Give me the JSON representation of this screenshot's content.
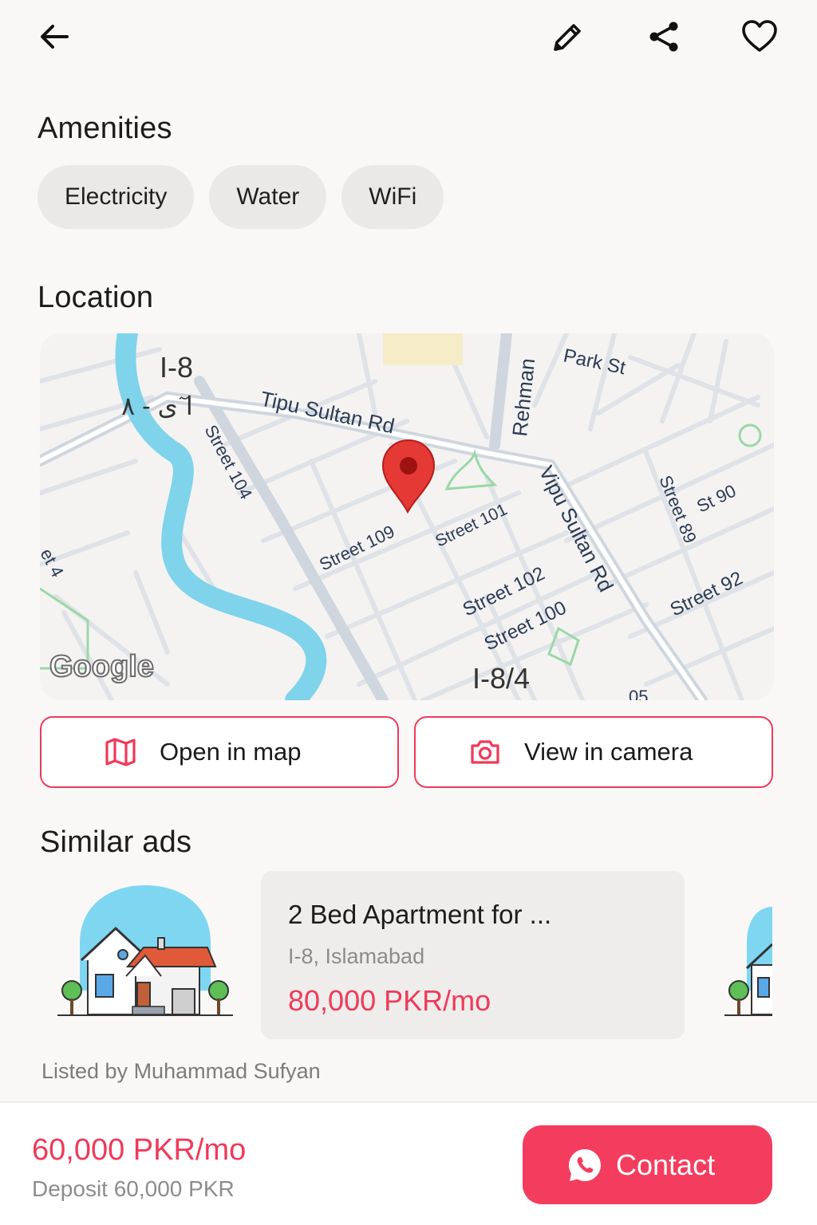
{
  "header": {
    "back_icon": "arrow-left-icon",
    "edit_icon": "pencil-icon",
    "share_icon": "share-icon",
    "favorite_icon": "heart-icon"
  },
  "amenities": {
    "title": "Amenities",
    "items": [
      "Electricity",
      "Water",
      "WiFi"
    ]
  },
  "location": {
    "title": "Location",
    "map": {
      "labels": {
        "sector_top": "I-8",
        "sector_urdu": "ا ٓی - ۸",
        "tipu_sultan": "Tipu Sultan Rd",
        "vipu_sultan": "Vipu Sultan Rd",
        "rehman": "Rehman",
        "park_st": "Park St",
        "street_104": "Street 104",
        "street_109": "Street 109",
        "street_101": "Street 101",
        "street_102": "Street 102",
        "street_100": "Street 100",
        "street_89": "Street 89",
        "st_90": "St 90",
        "street_92": "Street 92",
        "sector_bottom": "I-8/4",
        "edge_left": "et 4",
        "edge_bottom": "05",
        "google": "Google"
      },
      "pin_icon": "map-pin-icon"
    },
    "open_map_label": "Open in map",
    "open_map_icon": "map-icon",
    "camera_label": "View in camera",
    "camera_icon": "camera-icon"
  },
  "similar": {
    "title": "Similar ads",
    "ad": {
      "title": "2 Bed Apartment for ...",
      "location": "I-8, Islamabad",
      "price": "80,000 PKR/mo"
    },
    "listed_by": "Listed by Muhammad Sufyan"
  },
  "footer": {
    "price": "60,000 PKR/mo",
    "deposit": "Deposit 60,000 PKR",
    "contact_label": "Contact",
    "contact_icon": "whatsapp-icon"
  },
  "colors": {
    "accent": "#ef3a5a",
    "chip_bg": "#ebe9e7",
    "water": "#7fd3ea",
    "pin": "#e53935"
  }
}
